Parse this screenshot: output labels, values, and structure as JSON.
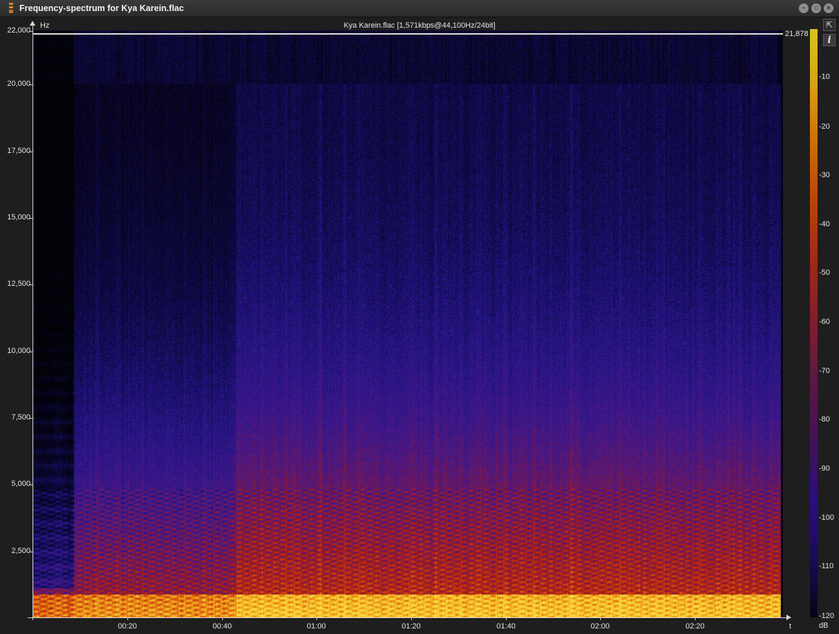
{
  "window": {
    "title": "Frequency-spectrum for Kya Karein.flac"
  },
  "plot": {
    "file_info": "Kya Karein.flac [1,571kbps@44,100Hz/24bit]",
    "y_unit": "Hz",
    "x_unit": "t",
    "cutoff_label": "21,878"
  },
  "y_ticks": [
    "22,000",
    "20,000",
    "17,500",
    "15,000",
    "12,500",
    "10,000",
    "7,500",
    "5,000",
    "2,500"
  ],
  "x_ticks": [
    "00:20",
    "00:40",
    "01:00",
    "01:20",
    "01:40",
    "02:00",
    "02:20"
  ],
  "colorbar": {
    "unit": "dB",
    "labels": [
      "-10",
      "-20",
      "-30",
      "-40",
      "-50",
      "-60",
      "-70",
      "-80",
      "-90",
      "-100",
      "-110",
      "-120"
    ]
  },
  "icons": {
    "export": "export-icon",
    "info": "info-icon"
  }
}
